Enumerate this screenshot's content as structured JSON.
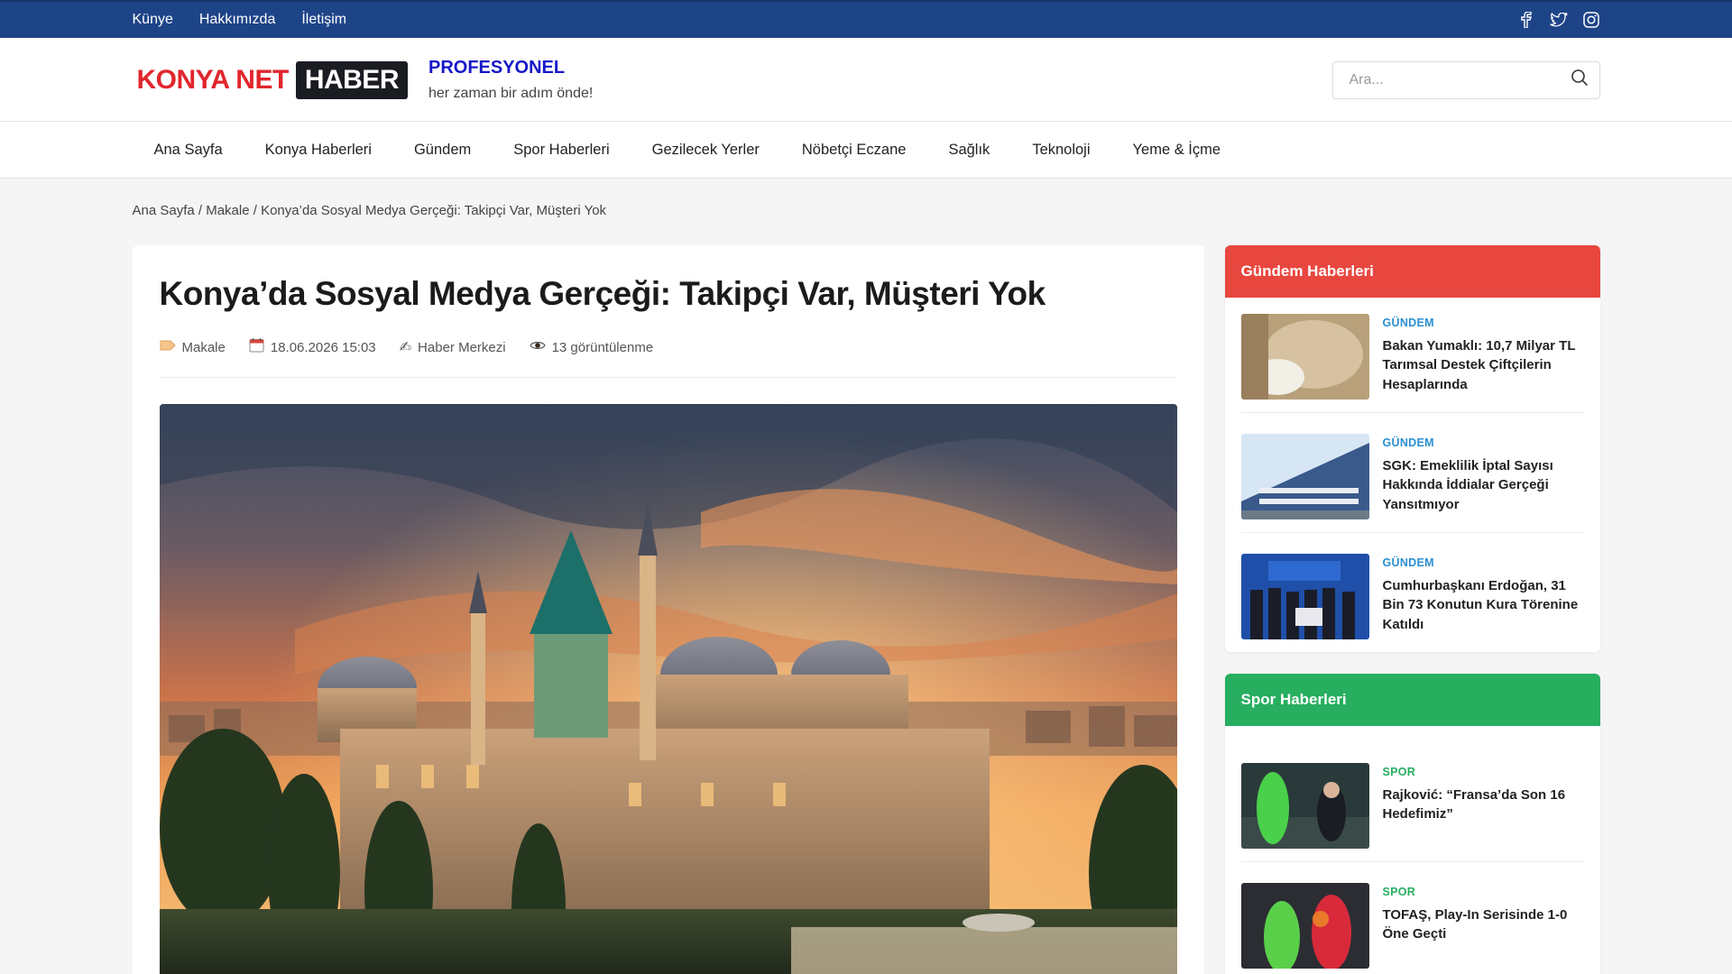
{
  "topbar": {
    "links": [
      "Künye",
      "Hakkımızda",
      "İletişim"
    ],
    "social": [
      "facebook-icon",
      "twitter-icon",
      "instagram-icon"
    ]
  },
  "header": {
    "logo_red": "KONYA NET",
    "logo_black": "HABER",
    "slogan_title": "PROFESYONEL",
    "slogan_sub": "her zaman bir adım önde!",
    "search_placeholder": "Ara..."
  },
  "nav": [
    "Ana Sayfa",
    "Konya Haberleri",
    "Gündem",
    "Spor Haberleri",
    "Gezilecek Yerler",
    "Nöbetçi Eczane",
    "Sağlık",
    "Teknoloji",
    "Yeme & İçme"
  ],
  "breadcrumb": "Ana Sayfa / Makale / Konya’da Sosyal Medya Gerçeği: Takipçi Var, Müşteri Yok",
  "article": {
    "title": "Konya’da Sosyal Medya Gerçeği: Takipçi Var, Müşteri Yok",
    "category": "Makale",
    "date": "18.06.2026 15:03",
    "author": "Haber Merkezi",
    "views": "13 görüntülenme"
  },
  "sidebar": {
    "gundem": {
      "title": "Gündem Haberleri",
      "color": "#e8473f",
      "items": [
        {
          "cat": "GÜNDEM",
          "title": "Bakan Yumaklı: 10,7 Milyar TL Tarımsal Destek Çiftçilerin Hesaplarında"
        },
        {
          "cat": "GÜNDEM",
          "title": "SGK: Emeklilik İptal Sayısı Hakkında İddialar Gerçeği Yansıtmıyor"
        },
        {
          "cat": "GÜNDEM",
          "title": "Cumhurbaşkanı Erdoğan, 31 Bin 73 Konutun Kura Törenine Katıldı"
        }
      ]
    },
    "spor": {
      "title": "Spor Haberleri",
      "color": "#27ae5f",
      "items": [
        {
          "cat": "SPOR",
          "title": "Rajković: “Fransa’da Son 16 Hedefimiz”"
        },
        {
          "cat": "SPOR",
          "title": "TOFAŞ, Play-In Serisinde 1-0 Öne Geçti"
        }
      ]
    }
  },
  "colors": {
    "topbar": "#1e4488",
    "gundem_cat": "#2a8fd0",
    "spor_cat": "#27ae5f"
  }
}
